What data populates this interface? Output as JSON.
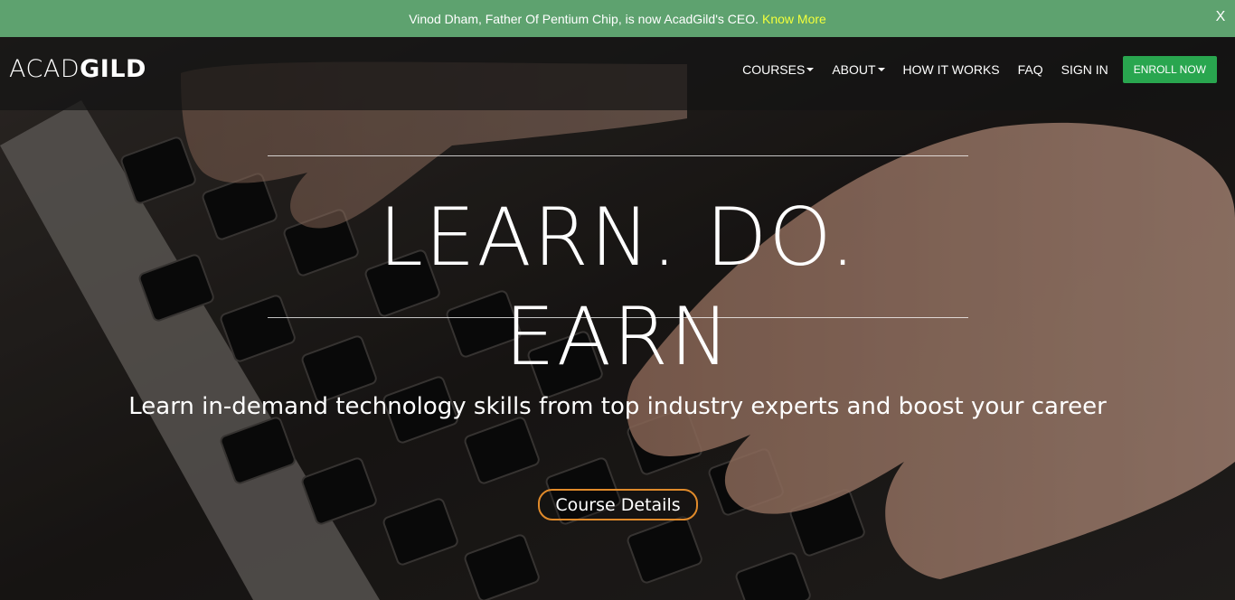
{
  "announcement": {
    "text": "Vinod Dham, Father Of Pentium Chip, is now AcadGild's CEO.",
    "link_label": "Know More",
    "close_label": "X"
  },
  "brand": {
    "logo_light": "ACAD",
    "logo_bold": "GILD"
  },
  "nav": {
    "items": [
      {
        "label": "COURSES",
        "dropdown": true
      },
      {
        "label": "ABOUT",
        "dropdown": true
      },
      {
        "label": "HOW IT WORKS",
        "dropdown": false
      },
      {
        "label": "FAQ",
        "dropdown": false
      },
      {
        "label": "SIGN IN",
        "dropdown": false
      }
    ],
    "cta_label": "ENROLL NOW"
  },
  "hero": {
    "headline": "LEARN. DO. EARN",
    "tagline": "Learn in-demand technology skills from top industry experts and boost your career",
    "button_label": "Course Details"
  },
  "colors": {
    "announce_bg": "#5ea26f",
    "link_yellow": "#f2ff3b",
    "enroll_green": "#29a64f",
    "button_border": "#e08a2a"
  }
}
